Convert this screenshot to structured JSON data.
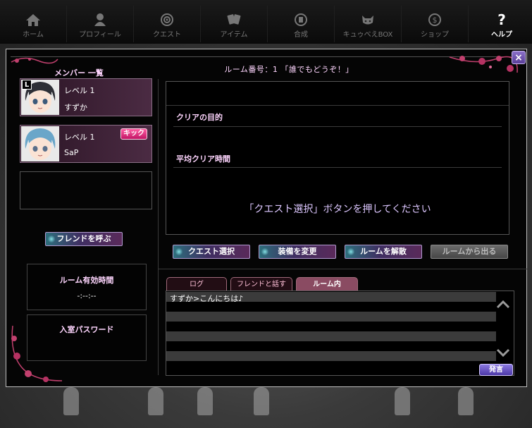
{
  "nav": {
    "items": [
      {
        "label": "ホーム",
        "icon": "home-icon"
      },
      {
        "label": "プロフィール",
        "icon": "person-icon"
      },
      {
        "label": "クエスト",
        "icon": "target-icon"
      },
      {
        "label": "アイテム",
        "icon": "cards-icon"
      },
      {
        "label": "合成",
        "icon": "gem-icon"
      },
      {
        "label": "キュゥべえBOX",
        "icon": "kyubey-icon"
      },
      {
        "label": "ショップ",
        "icon": "coin-icon"
      },
      {
        "label": "ヘルプ",
        "icon": "question-icon",
        "active": true
      }
    ],
    "help_glyph": "?"
  },
  "dialog": {
    "close_label": "×",
    "room_title": "ルーム番号：1 「誰でもどうぞ！」"
  },
  "members": {
    "header": "メンバー 一覧",
    "leader_badge": "L",
    "kick_label": "キック",
    "list": [
      {
        "level": "レベル 1",
        "name": "すずか",
        "is_leader": true
      },
      {
        "level": "レベル 1",
        "name": "SaP",
        "is_leader": false
      }
    ]
  },
  "left_panel": {
    "call_friend_label": "フレンドを呼ぶ",
    "room_time_title": "ルーム有効時間",
    "room_time_value": "-:--:--",
    "password_title": "入室パスワード"
  },
  "quest": {
    "goal_label": "クリアの目的",
    "avg_time_label": "平均クリア時間",
    "message": "「クエスト選択」ボタンを押してください"
  },
  "actions": {
    "select_quest": "クエスト選択",
    "change_equip": "装備を変更",
    "dissolve_room": "ルームを解散",
    "leave_room": "ルームから出る"
  },
  "chat": {
    "tabs": [
      {
        "label": "ログ"
      },
      {
        "label": "フレンドと話す"
      },
      {
        "label": "ルーム内",
        "active": true
      }
    ],
    "messages": [
      "すずか>こんにちは♪"
    ],
    "send_label": "発言"
  },
  "colors": {
    "accent_pink": "#ffd6ff",
    "kick_pink": "#e02a7e",
    "tab_active": "#8a4b62",
    "send_purple": "#6b57c8"
  }
}
